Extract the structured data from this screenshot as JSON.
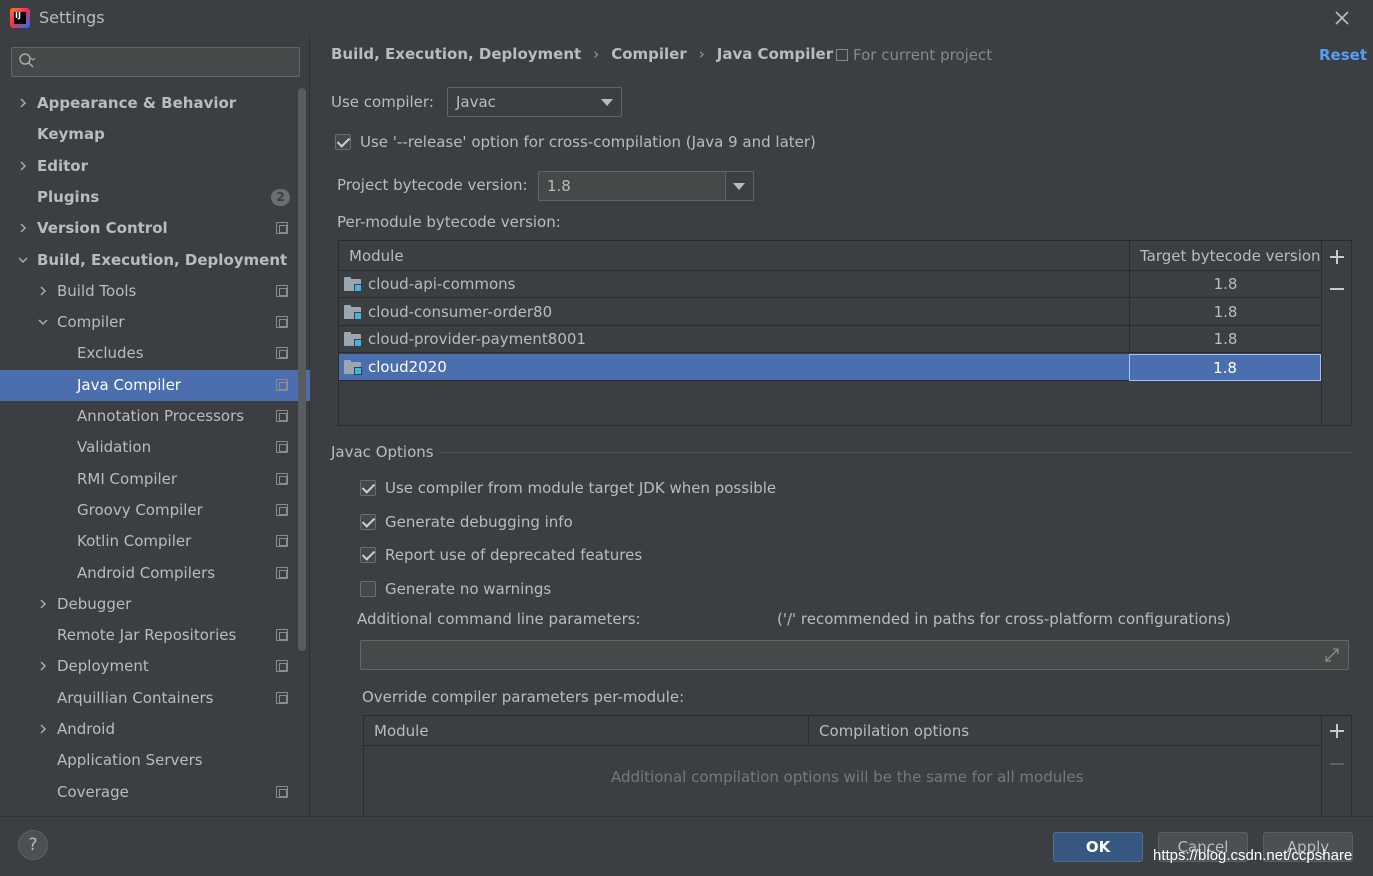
{
  "window": {
    "title": "Settings"
  },
  "search": {
    "placeholder": ""
  },
  "sidebar": {
    "items": [
      {
        "label": "Appearance & Behavior",
        "bold": true,
        "level": 0,
        "chevron": "right",
        "icon": null
      },
      {
        "label": "Keymap",
        "bold": true,
        "level": 0,
        "chevron": null,
        "icon": null
      },
      {
        "label": "Editor",
        "bold": true,
        "level": 0,
        "chevron": "right",
        "icon": null
      },
      {
        "label": "Plugins",
        "bold": true,
        "level": 0,
        "chevron": null,
        "icon": "badge",
        "badge": "2"
      },
      {
        "label": "Version Control",
        "bold": true,
        "level": 0,
        "chevron": "right",
        "icon": "project"
      },
      {
        "label": "Build, Execution, Deployment",
        "bold": true,
        "level": 0,
        "chevron": "down",
        "icon": null
      },
      {
        "label": "Build Tools",
        "bold": false,
        "level": 1,
        "chevron": "right",
        "icon": "project"
      },
      {
        "label": "Compiler",
        "bold": false,
        "level": 1,
        "chevron": "down",
        "icon": "project"
      },
      {
        "label": "Excludes",
        "bold": false,
        "level": 2,
        "chevron": null,
        "icon": "project"
      },
      {
        "label": "Java Compiler",
        "bold": false,
        "level": 2,
        "chevron": null,
        "icon": "project",
        "selected": true
      },
      {
        "label": "Annotation Processors",
        "bold": false,
        "level": 2,
        "chevron": null,
        "icon": "project"
      },
      {
        "label": "Validation",
        "bold": false,
        "level": 2,
        "chevron": null,
        "icon": "project"
      },
      {
        "label": "RMI Compiler",
        "bold": false,
        "level": 2,
        "chevron": null,
        "icon": "project"
      },
      {
        "label": "Groovy Compiler",
        "bold": false,
        "level": 2,
        "chevron": null,
        "icon": "project"
      },
      {
        "label": "Kotlin Compiler",
        "bold": false,
        "level": 2,
        "chevron": null,
        "icon": "project"
      },
      {
        "label": "Android Compilers",
        "bold": false,
        "level": 2,
        "chevron": null,
        "icon": "project"
      },
      {
        "label": "Debugger",
        "bold": false,
        "level": 1,
        "chevron": "right",
        "icon": null
      },
      {
        "label": "Remote Jar Repositories",
        "bold": false,
        "level": 1,
        "chevron": null,
        "icon": "project"
      },
      {
        "label": "Deployment",
        "bold": false,
        "level": 1,
        "chevron": "right",
        "icon": "project"
      },
      {
        "label": "Arquillian Containers",
        "bold": false,
        "level": 1,
        "chevron": null,
        "icon": "project"
      },
      {
        "label": "Android",
        "bold": false,
        "level": 1,
        "chevron": "right",
        "icon": null
      },
      {
        "label": "Application Servers",
        "bold": false,
        "level": 1,
        "chevron": null,
        "icon": null
      },
      {
        "label": "Coverage",
        "bold": false,
        "level": 1,
        "chevron": null,
        "icon": "project"
      }
    ]
  },
  "breadcrumb": [
    "Build, Execution, Deployment",
    "Compiler",
    "Java Compiler"
  ],
  "breadcrumb_sep": "›",
  "scope": "For current project",
  "reset": "Reset",
  "use_compiler": {
    "label": "Use compiler:",
    "value": "Javac"
  },
  "release_option": {
    "label": "Use '--release' option for cross-compilation (Java 9 and later)",
    "checked": true
  },
  "project_bytecode": {
    "label": "Project bytecode version:",
    "value": "1.8"
  },
  "per_module_label": "Per-module bytecode version:",
  "module_table": {
    "headers": [
      "Module",
      "Target bytecode version"
    ],
    "rows": [
      {
        "module": "cloud-api-commons",
        "version": "1.8"
      },
      {
        "module": "cloud-consumer-order80",
        "version": "1.8"
      },
      {
        "module": "cloud-provider-payment8001",
        "version": "1.8"
      },
      {
        "module": "cloud2020",
        "version": "1.8",
        "selected": true
      }
    ]
  },
  "javac": {
    "section": "Javac Options",
    "options": [
      {
        "label": "Use compiler from module target JDK when possible",
        "checked": true
      },
      {
        "label": "Generate debugging info",
        "checked": true
      },
      {
        "label": "Report use of deprecated features",
        "checked": true
      },
      {
        "label": "Generate no warnings",
        "checked": false
      }
    ],
    "params_label": "Additional command line parameters:",
    "params_hint": "('/' recommended in paths for cross-platform configurations)",
    "params_value": "",
    "override_label": "Override compiler parameters per-module:",
    "override_headers": [
      "Module",
      "Compilation options"
    ],
    "override_empty": "Additional compilation options will be the same for all modules"
  },
  "buttons": {
    "help": "?",
    "ok": "OK",
    "cancel": "Cancel",
    "apply": "Apply"
  },
  "watermark": "https://blog.csdn.net/ccpshare",
  "colors": {
    "background": "#3c3f41",
    "selection": "#4b6eaf",
    "link": "#589df6",
    "ok_button": "#365880"
  }
}
